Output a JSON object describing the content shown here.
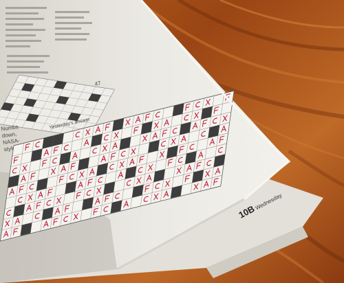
{
  "photo": {
    "subject": "newspaper crossword puzzle on a wooden table",
    "colors": {
      "wood_dark": "#6e2f0c",
      "wood_mid": "#a24f1a",
      "wood_light": "#c8732e",
      "paper": "#e7e5de",
      "paper_shadow": "#c9c6bd",
      "grid_black": "#3d3d3d",
      "ink_red": "#c0203a",
      "print_gray": "#555555"
    }
  },
  "newspaper": {
    "puzzle_number": "47",
    "yesterday_label": "Yesterday's answer",
    "side_clue_lines": [
      "Numbs",
      "down,",
      "NASA-",
      "style"
    ],
    "page_label": "10B",
    "page_section": "Wednesday"
  }
}
